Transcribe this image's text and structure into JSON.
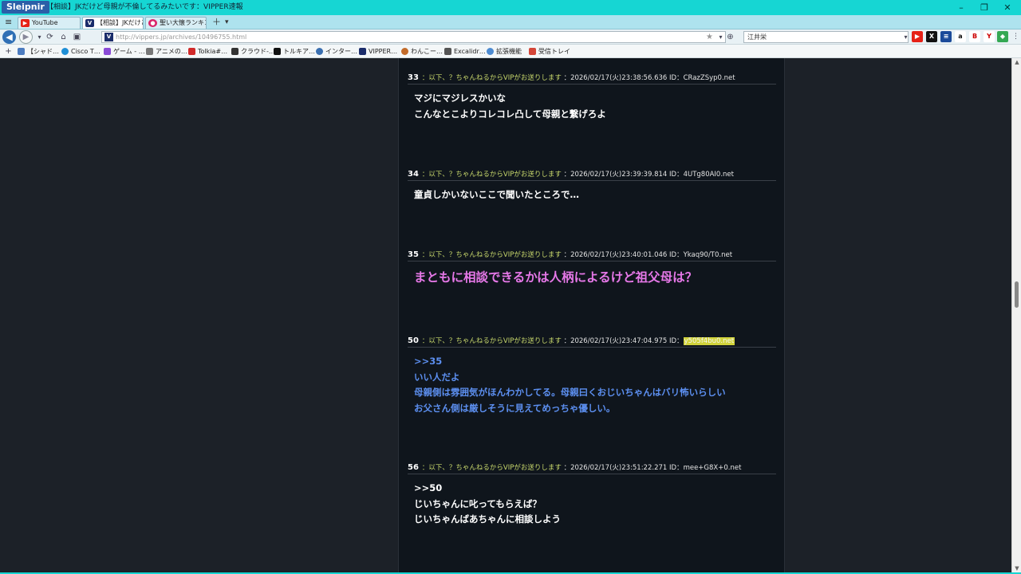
{
  "window": {
    "app_name": "Sleipnir",
    "title": "【相談】JKだけど母親が不倫してるみたいです：VIPPER速報",
    "minimize": "–",
    "restore": "❐",
    "close": "✕"
  },
  "tabs": [
    {
      "label": "YouTube",
      "icon": "youtube-icon",
      "color": "#e62117"
    },
    {
      "label": "【相談】JKだけど…",
      "icon": "vipper-icon",
      "color": "#1b2d6b"
    },
    {
      "label": "聖い大懐ランキン…",
      "icon": "site-icon",
      "color": "#d9256b"
    }
  ],
  "tab_add": "＋",
  "tab_menu": "▾",
  "address": {
    "url_host": "http://vippers.jp",
    "url_path": "/archives/10496755.html",
    "favicon_letter": "V",
    "search_value": "江井栄"
  },
  "bookmarks": [
    {
      "label": "【シャド…",
      "color": "#4c7cc0"
    },
    {
      "label": "Cisco T…",
      "color": "#1f8fd6"
    },
    {
      "label": "ゲーム - …",
      "color": "#8a4bd6"
    },
    {
      "label": "アニメの…",
      "color": "#777777"
    },
    {
      "label": "Tolkia#…",
      "color": "#d12a2a"
    },
    {
      "label": "クラウド-…",
      "color": "#333333"
    },
    {
      "label": "トルキア…",
      "color": "#111111"
    },
    {
      "label": "インター…",
      "color": "#3a6fb0"
    },
    {
      "label": "VIPPER…",
      "color": "#1b2d6b"
    },
    {
      "label": "わんこー…",
      "color": "#c26b2a"
    },
    {
      "label": "Excalidr…",
      "color": "#555555"
    },
    {
      "label": "拡張機能",
      "color": "#4d8bd1"
    },
    {
      "label": "受信トレイ",
      "color": "#d44638"
    }
  ],
  "posts": [
    {
      "number": "33",
      "name": "：以下、？ちゃんねるからVIPがお送りします",
      "datetime": "：2026/02/17(火)23:38:56.636 ID：",
      "id": "CRazZSyp0.net",
      "style": "white",
      "lines": [
        "マジにマジレスかいな",
        "こんなとこよりコレコレ凸して母親と繋げろよ"
      ]
    },
    {
      "number": "34",
      "name": "：以下、？ちゃんねるからVIPがお送りします",
      "datetime": "：2026/02/17(火)23:39:39.814 ID：",
      "id": "4UTg80AI0.net",
      "style": "white",
      "lines": [
        "童貞しかいないここで聞いたところで…"
      ]
    },
    {
      "number": "35",
      "name": "：以下、？ちゃんねるからVIPがお送りします",
      "datetime": "：2026/02/17(火)23:40:01.046 ID：",
      "id": "Ykaq90/T0.net",
      "style": "pink",
      "lines": [
        "まともに相談できるかは人柄によるけど祖父母は？"
      ]
    },
    {
      "number": "50",
      "name": "：以下、？ちゃんねるからVIPがお送りします",
      "datetime": "：2026/02/17(火)23:47:04.975 ID：",
      "id": "y505f4bu0.net",
      "id_highlight": true,
      "style": "blue",
      "lines": [
        ">>35",
        "いい人だよ",
        "母親側は雰囲気がほんわかしてる。母親曰くおじいちゃんはバリ怖いらしい",
        "お父さん側は厳しそうに見えてめっちゃ優しい。"
      ]
    },
    {
      "number": "56",
      "name": "：以下、？ちゃんねるからVIPがお送りします",
      "datetime": "：2026/02/17(火)23:51:22.271 ID：",
      "id": "mee+G8X+0.net",
      "style": "white",
      "lines": [
        ">>50",
        "じいちゃんに叱ってもらえば？",
        "じいちゃんばあちゃんに相談しよう"
      ]
    }
  ]
}
